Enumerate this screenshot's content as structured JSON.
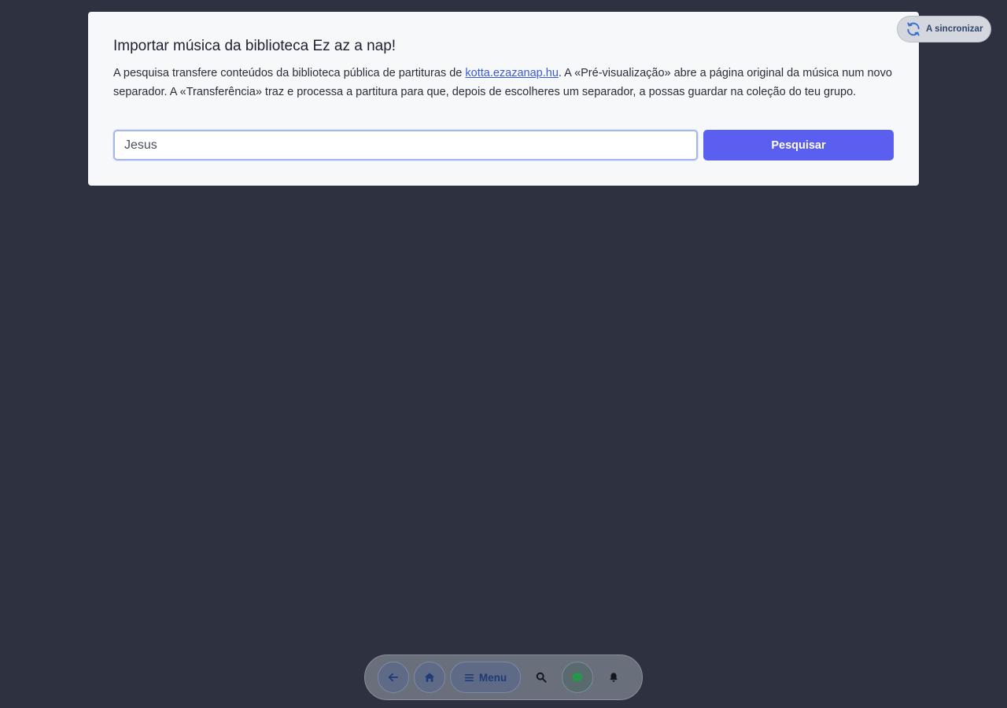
{
  "dialog": {
    "title": "Importar música da biblioteca Ez az a nap!",
    "description_before_link": "A pesquisa transfere conteúdos da biblioteca pública de partituras de ",
    "link_text": "kotta.ezazanap.hu",
    "description_after_link": ". A «Pré-visualização» abre a página original da música num novo separador. A «Transferência» traz e processa a partitura para que, depois de escolheres um separador, a possas guardar na coleção do teu grupo.",
    "search_value": "Jesus",
    "search_button": "Pesquisar"
  },
  "sync": {
    "label": "A sincronizar",
    "icon": "sync-icon"
  },
  "bottom_nav": {
    "menu_label": "Menu",
    "items": [
      "back-icon",
      "home-icon",
      "menu-icon",
      "search-icon",
      "chat-icon",
      "bell-icon"
    ]
  },
  "colors": {
    "background": "#2e3240",
    "card": "#f6f8fa",
    "accent": "#5a5ff0",
    "link": "#3b5bd6"
  }
}
